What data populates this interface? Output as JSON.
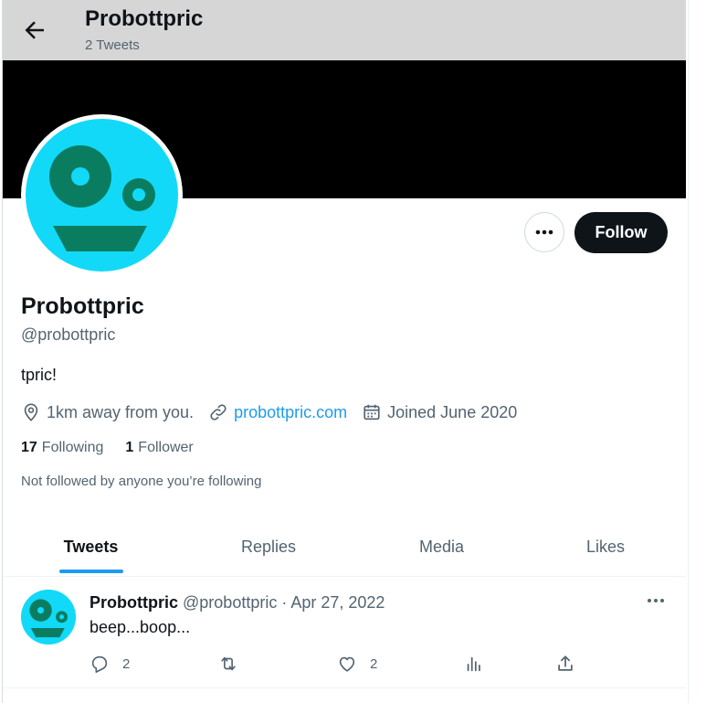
{
  "header": {
    "title": "Probottpric",
    "subtitle": "2 Tweets"
  },
  "profile": {
    "name": "Probottpric",
    "handle": "@probottpric",
    "bio": "tpric!",
    "location": "1km away from you.",
    "website": "probottpric.com",
    "joined": "Joined June 2020",
    "following_count": "17",
    "following_label": "Following",
    "followers_count": "1",
    "followers_label": "Follower",
    "not_followed": "Not followed by anyone you’re following",
    "follow_label": "Follow"
  },
  "tabs": [
    {
      "label": "Tweets",
      "active": true
    },
    {
      "label": "Replies",
      "active": false
    },
    {
      "label": "Media",
      "active": false
    },
    {
      "label": "Likes",
      "active": false
    }
  ],
  "tweet": {
    "name": "Probottpric",
    "meta": "@probottpric · Apr 27, 2022",
    "text": "beep...boop...",
    "replies": "2",
    "likes": "2"
  },
  "icons": {
    "back": "arrow-left-icon",
    "more": "more-horizontal-icon",
    "location": "location-pin-icon",
    "link": "link-icon",
    "calendar": "calendar-icon",
    "reply": "reply-icon",
    "retweet": "retweet-icon",
    "like": "heart-icon",
    "views": "analytics-icon",
    "share": "share-icon"
  },
  "colors": {
    "accent": "#1d9bf0",
    "avatar_bg": "#12d9f8",
    "avatar_fg": "#0a7d61",
    "banner": "#000000",
    "header_bg": "#d6d6d6"
  }
}
